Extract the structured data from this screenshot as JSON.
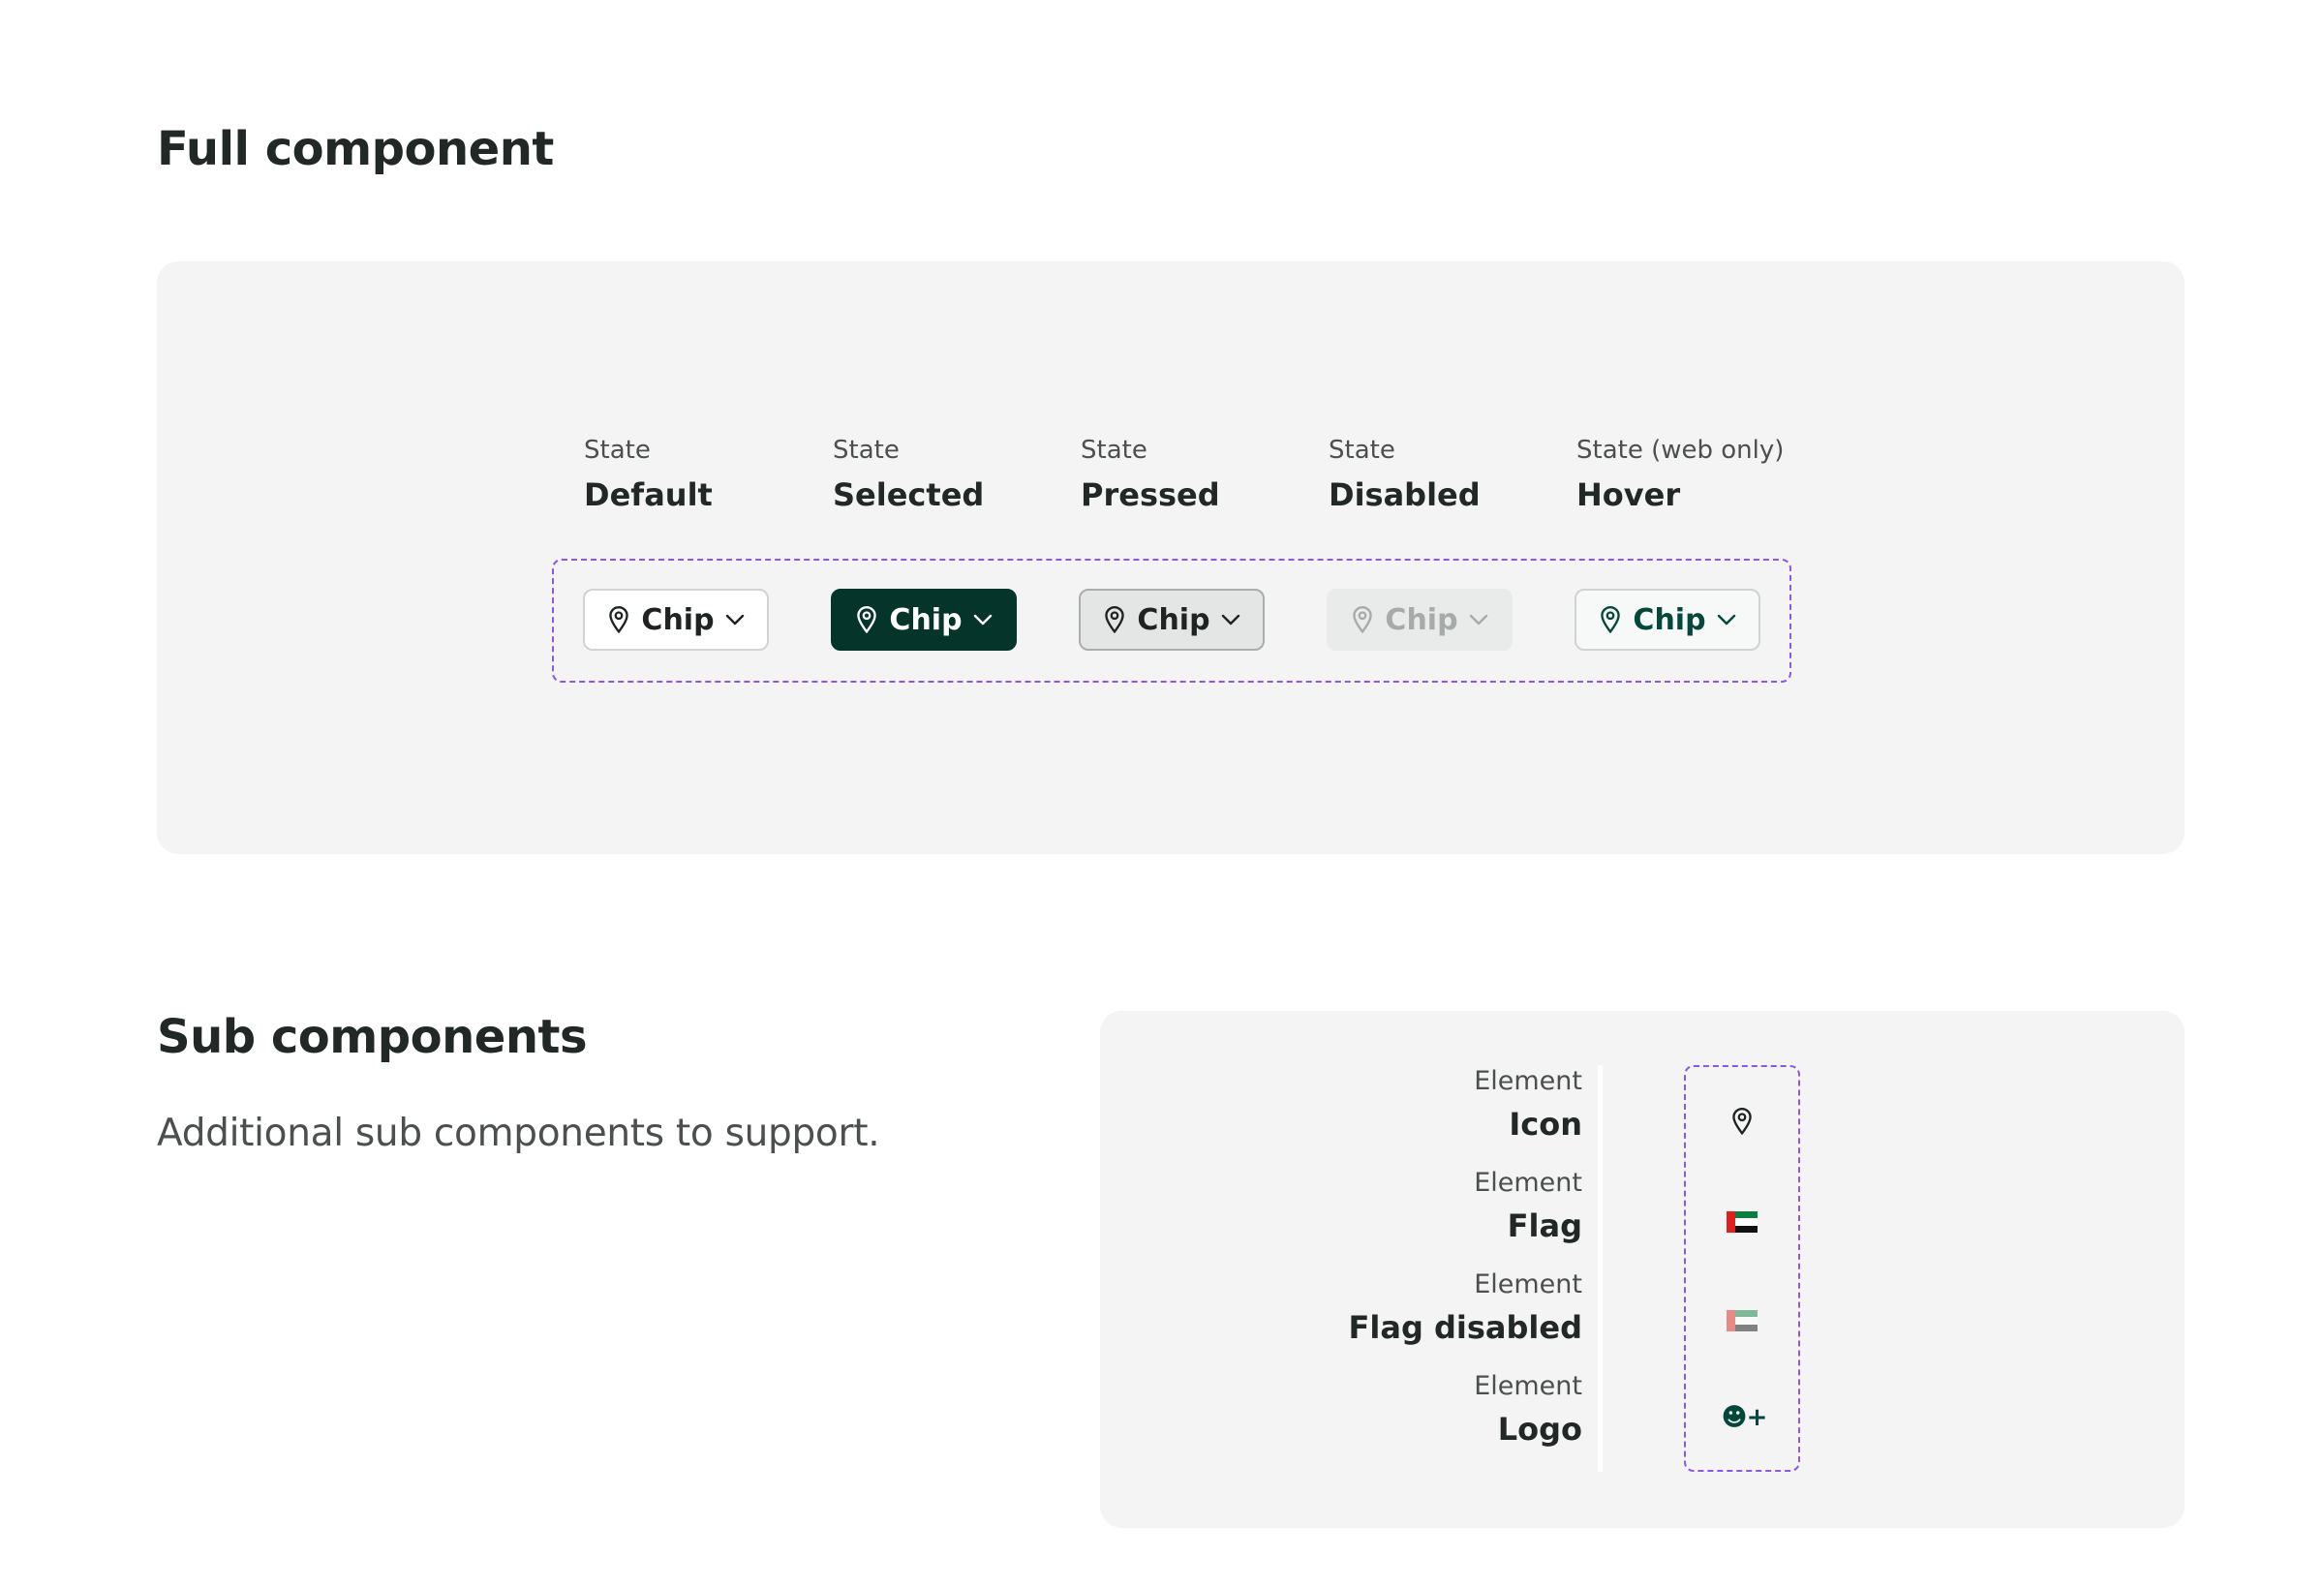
{
  "full": {
    "title": "Full component",
    "states": [
      {
        "caption": "State",
        "name": "Default"
      },
      {
        "caption": "State",
        "name": "Selected"
      },
      {
        "caption": "State",
        "name": "Pressed"
      },
      {
        "caption": "State",
        "name": "Disabled"
      },
      {
        "caption": "State (web only)",
        "name": "Hover"
      }
    ],
    "chips": [
      {
        "label": "Chip",
        "state": "default"
      },
      {
        "label": "Chip",
        "state": "selected"
      },
      {
        "label": "Chip",
        "state": "pressed"
      },
      {
        "label": "Chip",
        "state": "disabled"
      },
      {
        "label": "Chip",
        "state": "hover"
      }
    ]
  },
  "sub": {
    "title": "Sub components",
    "description": "Additional sub components to support.",
    "elements": [
      {
        "caption": "Element",
        "name": "Icon",
        "icon": "location-pin-icon"
      },
      {
        "caption": "Element",
        "name": "Flag",
        "icon": "uae-flag-icon"
      },
      {
        "caption": "Element",
        "name": "Flag disabled",
        "icon": "uae-flag-disabled-icon"
      },
      {
        "caption": "Element",
        "name": "Logo",
        "icon": "brand-logo-icon",
        "logo_text": "☻+"
      }
    ]
  },
  "colors": {
    "accent_dark_green": "#05342a",
    "frame_purple": "#8a55f0",
    "panel_bg": "#f3f4f3",
    "flag_red": "#e0201c",
    "flag_green": "#0a7f3f"
  }
}
